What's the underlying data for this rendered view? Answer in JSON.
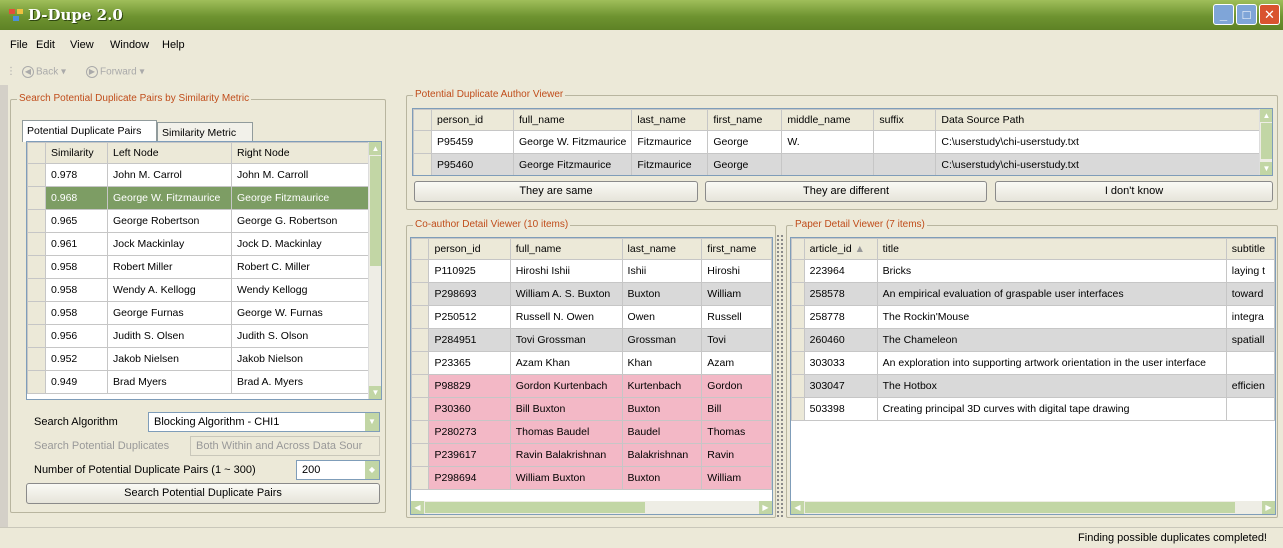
{
  "window": {
    "title": "D-Dupe 2.0",
    "min": "_",
    "max": "□",
    "close": "✕"
  },
  "menu": [
    "File",
    "Edit",
    "View",
    "Window",
    "Help"
  ],
  "toolbar": {
    "back": "Back",
    "forward": "Forward"
  },
  "search_panel": {
    "legend": "Search Potential Duplicate Pairs by Similarity Metric",
    "tabs": [
      "Potential Duplicate Pairs",
      "Similarity Metric"
    ],
    "columns": [
      "Similarity",
      "Left Node",
      "Right Node"
    ],
    "rows": [
      [
        "0.978",
        "John M. Carrol",
        "John M. Carroll"
      ],
      [
        "0.968",
        "George W. Fitzmaurice",
        "George Fitzmaurice"
      ],
      [
        "0.965",
        "George Robertson",
        "George G. Robertson"
      ],
      [
        "0.961",
        "Jock Mackinlay",
        "Jock D. Mackinlay"
      ],
      [
        "0.958",
        "Robert Miller",
        "Robert C. Miller"
      ],
      [
        "0.958",
        "Wendy A. Kellogg",
        "Wendy Kellogg"
      ],
      [
        "0.958",
        "George Furnas",
        "George W. Furnas"
      ],
      [
        "0.956",
        "Judith S. Olsen",
        "Judith S. Olson"
      ],
      [
        "0.952",
        "Jakob Nielsen",
        "Jakob Nielson"
      ],
      [
        "0.949",
        "Brad Myers",
        "Brad A. Myers"
      ]
    ],
    "algorithm_label": "Search Algorithm",
    "algorithm_value": "Blocking Algorithm - CHI1",
    "duplicates_label": "Search Potential Duplicates",
    "duplicates_value": "Both Within and Across Data Sour",
    "count_label": "Number of Potential Duplicate Pairs  (1 ~ 300)",
    "count_value": "200",
    "search_button": "Search Potential Duplicate Pairs"
  },
  "author_viewer": {
    "legend": "Potential Duplicate Author Viewer",
    "columns": [
      "person_id",
      "full_name",
      "last_name",
      "first_name",
      "middle_name",
      "suffix",
      "Data Source Path"
    ],
    "rows": [
      [
        "P95459",
        "George W. Fitzmaurice",
        "Fitzmaurice",
        "George",
        "W.",
        "",
        "C:\\userstudy\\chi-userstudy.txt"
      ],
      [
        "P95460",
        "George  Fitzmaurice",
        "Fitzmaurice",
        "George",
        "",
        "",
        "C:\\userstudy\\chi-userstudy.txt"
      ]
    ],
    "buttons": [
      "They are same",
      "They are different",
      "I don't know"
    ]
  },
  "coauthor_viewer": {
    "legend": "Co-author Detail Viewer (10 items)",
    "columns": [
      "person_id",
      "full_name",
      "last_name",
      "first_name"
    ],
    "rows": [
      [
        "P110925",
        "Hiroshi  Ishii",
        "Ishii",
        "Hiroshi"
      ],
      [
        "P298693",
        "William A. S. Buxton",
        "Buxton",
        "William"
      ],
      [
        "P250512",
        "Russell N. Owen",
        "Owen",
        "Russell"
      ],
      [
        "P284951",
        "Tovi  Grossman",
        "Grossman",
        "Tovi"
      ],
      [
        "P23365",
        "Azam  Khan",
        "Khan",
        "Azam"
      ],
      [
        "P98829",
        "Gordon  Kurtenbach",
        "Kurtenbach",
        "Gordon"
      ],
      [
        "P30360",
        "Bill  Buxton",
        "Buxton",
        "Bill"
      ],
      [
        "P280273",
        "Thomas  Baudel",
        "Baudel",
        "Thomas"
      ],
      [
        "P239617",
        "Ravin  Balakrishnan",
        "Balakrishnan",
        "Ravin"
      ],
      [
        "P298694",
        "William  Buxton",
        "Buxton",
        "William"
      ]
    ]
  },
  "paper_viewer": {
    "legend": "Paper Detail Viewer (7 items)",
    "columns": [
      "article_id",
      "title",
      "subtitle"
    ],
    "rows": [
      [
        "223964",
        "Bricks",
        "laying t"
      ],
      [
        "258578",
        "An empirical evaluation of graspable user interfaces",
        "toward"
      ],
      [
        "258778",
        "The Rockin'Mouse",
        "integra"
      ],
      [
        "260460",
        "The Chameleon",
        "spatiall"
      ],
      [
        "303033",
        "An exploration into supporting artwork orientation in the user interface",
        ""
      ],
      [
        "303047",
        "The Hotbox",
        "efficien"
      ],
      [
        "503398",
        "Creating principal 3D curves with digital tape drawing",
        ""
      ]
    ]
  },
  "status": "Finding possible duplicates completed!",
  "colors": {
    "title_green": "#6e9330",
    "selected_row": "#7d9d64",
    "pink_row": "#f3b8c6",
    "legend_text": "#c04d1b"
  }
}
